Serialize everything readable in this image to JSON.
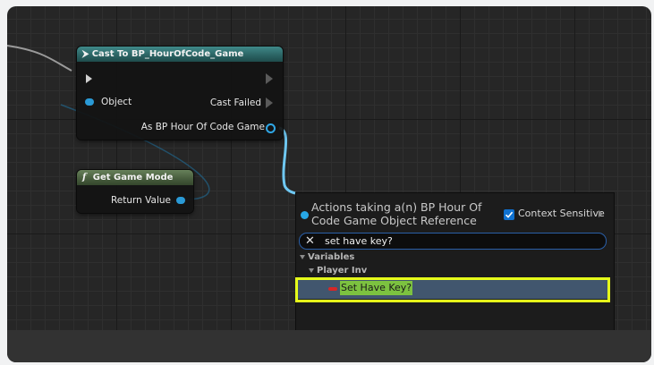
{
  "cast_node": {
    "title": "Cast To BP_HourOfCode_Game",
    "object_pin": "Object",
    "cast_failed_pin": "Cast Failed",
    "output_pin": "As BP Hour Of Code Game"
  },
  "get_game_mode_node": {
    "icon": "f",
    "title": "Get Game Mode",
    "output_pin": "Return Value"
  },
  "action_menu": {
    "title": "Actions taking a(n) BP Hour Of Code Game Object Reference",
    "context_sensitive_label": "Context Sensitive",
    "context_sensitive_checked": true,
    "search_value": "set have key?",
    "category": "Variables",
    "subcategory": "Player Inv",
    "result": "Set Have Key?"
  },
  "colors": {
    "highlight_outline": "#e6ff1a",
    "object_pin": "#2a9ad6",
    "selected_row": "#41566e",
    "match_highlight": "#7cc240"
  }
}
